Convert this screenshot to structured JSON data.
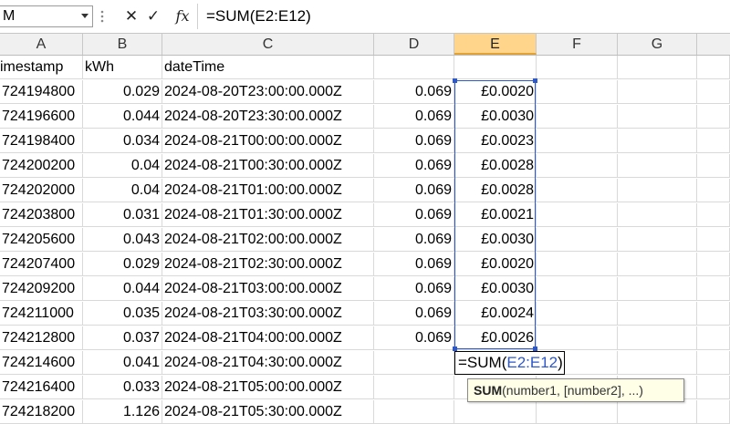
{
  "formula_bar": {
    "name_box": "M",
    "formula": "=SUM(E2:E12)",
    "fx_label": "fx"
  },
  "columns": [
    {
      "letter": "A",
      "selected": false
    },
    {
      "letter": "B",
      "selected": false
    },
    {
      "letter": "C",
      "selected": false
    },
    {
      "letter": "D",
      "selected": false
    },
    {
      "letter": "E",
      "selected": true
    },
    {
      "letter": "F",
      "selected": false
    },
    {
      "letter": "G",
      "selected": false
    }
  ],
  "rows": [
    {
      "a": "imestamp",
      "b": "kWh",
      "c": "dateTime",
      "d": "",
      "e": ""
    },
    {
      "a": "724194800",
      "b": "0.029",
      "c": "2024-08-20T23:00:00.000Z",
      "d": "0.069",
      "e": "£0.0020"
    },
    {
      "a": "724196600",
      "b": "0.044",
      "c": "2024-08-20T23:30:00.000Z",
      "d": "0.069",
      "e": "£0.0030"
    },
    {
      "a": "724198400",
      "b": "0.034",
      "c": "2024-08-21T00:00:00.000Z",
      "d": "0.069",
      "e": "£0.0023"
    },
    {
      "a": "724200200",
      "b": "0.04",
      "c": "2024-08-21T00:30:00.000Z",
      "d": "0.069",
      "e": "£0.0028"
    },
    {
      "a": "724202000",
      "b": "0.04",
      "c": "2024-08-21T01:00:00.000Z",
      "d": "0.069",
      "e": "£0.0028"
    },
    {
      "a": "724203800",
      "b": "0.031",
      "c": "2024-08-21T01:30:00.000Z",
      "d": "0.069",
      "e": "£0.0021"
    },
    {
      "a": "724205600",
      "b": "0.043",
      "c": "2024-08-21T02:00:00.000Z",
      "d": "0.069",
      "e": "£0.0030"
    },
    {
      "a": "724207400",
      "b": "0.029",
      "c": "2024-08-21T02:30:00.000Z",
      "d": "0.069",
      "e": "£0.0020"
    },
    {
      "a": "724209200",
      "b": "0.044",
      "c": "2024-08-21T03:00:00.000Z",
      "d": "0.069",
      "e": "£0.0030"
    },
    {
      "a": "724211000",
      "b": "0.035",
      "c": "2024-08-21T03:30:00.000Z",
      "d": "0.069",
      "e": "£0.0024"
    },
    {
      "a": "724212800",
      "b": "0.037",
      "c": "2024-08-21T04:00:00.000Z",
      "d": "0.069",
      "e": "£0.0026"
    },
    {
      "a": "724214600",
      "b": "0.041",
      "c": "2024-08-21T04:30:00.000Z",
      "d": "",
      "e": ""
    },
    {
      "a": "724216400",
      "b": "0.033",
      "c": "2024-08-21T05:00:00.000Z",
      "d": "",
      "e": ""
    },
    {
      "a": "724218200",
      "b": "1.126",
      "c": "2024-08-21T05:30:00.000Z",
      "d": "",
      "e": ""
    }
  ],
  "edit_cell": {
    "prefix": "=SUM(",
    "range": "E2:E12",
    "suffix": ")"
  },
  "tooltip": {
    "function": "SUM",
    "args": "(number1, [number2], ...)"
  },
  "colors": {
    "selection_border": "#2e58c8",
    "selected_header": "#ffd58c",
    "tooltip_bg": "#ffffe8"
  }
}
